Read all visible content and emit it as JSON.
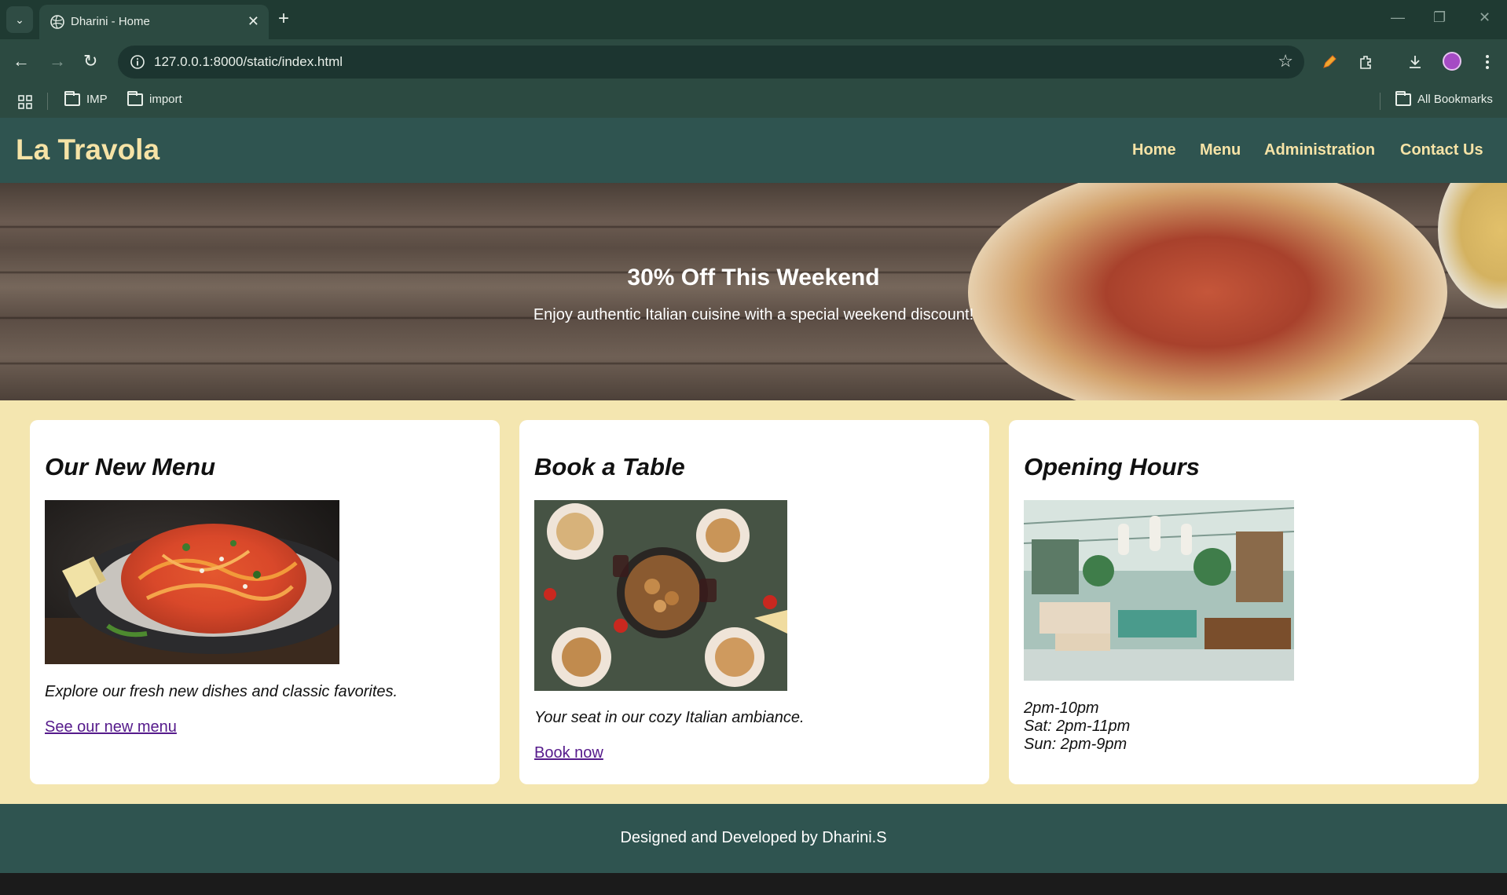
{
  "browser": {
    "tab_title": "Dharini - Home",
    "url": "127.0.0.1:8000/static/index.html",
    "bookmarks": [
      "IMP",
      "import"
    ],
    "all_bookmarks_label": "All Bookmarks"
  },
  "site": {
    "logo": "La Travola",
    "nav": [
      "Home",
      "Menu",
      "Administration",
      "Contact Us"
    ],
    "hero": {
      "title": "30% Off This Weekend",
      "subtitle": "Enjoy authentic Italian cuisine with a special weekend discount!"
    },
    "cards": [
      {
        "title": "Our New Menu",
        "text": "Explore our fresh new dishes and classic favorites.",
        "link": "See our new menu"
      },
      {
        "title": "Book a Table",
        "text": "Your seat in our cozy Italian ambiance.",
        "link": "Book now"
      },
      {
        "title": "Opening Hours",
        "hours": [
          "2pm-10pm",
          "Sat: 2pm-11pm",
          "Sun: 2pm-9pm"
        ]
      }
    ],
    "footer": "Designed and Developed by Dharini.S"
  },
  "colors": {
    "header_bg": "#2f5450",
    "accent_text": "#f6e3a6",
    "page_bg": "#f4e6b0",
    "link": "#551a8b"
  }
}
